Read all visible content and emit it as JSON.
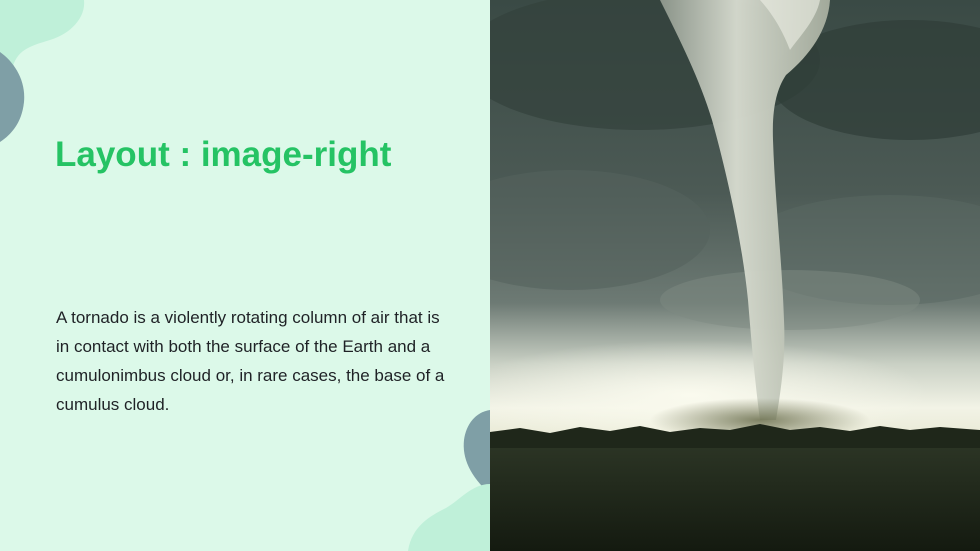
{
  "slide": {
    "title": "Layout : image-right",
    "body": "A tornado is a violently rotating column of air that is in contact with both the surface of the Earth and a cumulonimbus cloud or, in rare cases, the base of a cumulus cloud."
  },
  "image": {
    "subject": "tornado-photo"
  },
  "colors": {
    "panel_background": "#dcf9e9",
    "title": "#25c364",
    "body_text": "#1f2226",
    "blob_mint": "#bff0d9",
    "blob_slate": "#7f9fa6"
  }
}
